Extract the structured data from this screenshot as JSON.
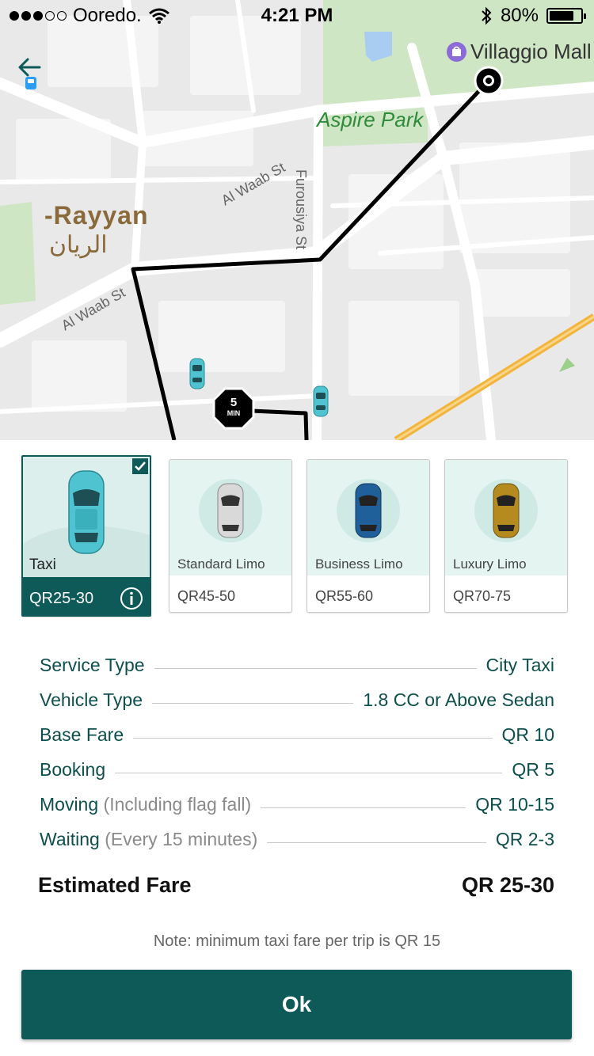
{
  "status_bar": {
    "carrier": "Ooredo.",
    "time": "4:21 PM",
    "battery": "80%",
    "signal_level": 3,
    "signal_total": 5
  },
  "map": {
    "labels": {
      "villaggio": "Villaggio Mall",
      "aspire": "Aspire Park",
      "rayyan": "-Rayyan",
      "rayyan_ar": "الريان",
      "al_waab_1": "Al Waab St",
      "al_waab_2": "Al Waab St",
      "furousiya": "Furousiya St"
    },
    "eta": {
      "value": "5",
      "unit": "MIN"
    },
    "icons": [
      "back-arrow-icon",
      "bus-icon",
      "mall-icon",
      "destination-pin-icon",
      "taxi-car-icon"
    ]
  },
  "vehicles": [
    {
      "name": "Taxi",
      "price": "QR25-30",
      "selected": true,
      "color": "#4fc3cf"
    },
    {
      "name": "Standard Limo",
      "price": "QR45-50",
      "selected": false,
      "color": "#d9d9d9"
    },
    {
      "name": "Business Limo",
      "price": "QR55-60",
      "selected": false,
      "color": "#1f5f9a"
    },
    {
      "name": "Luxury Limo",
      "price": "QR70-75",
      "selected": false,
      "color": "#b58a1f"
    }
  ],
  "fare": {
    "rows": [
      {
        "label": "Service Type",
        "sub": "",
        "value": "City Taxi"
      },
      {
        "label": "Vehicle Type",
        "sub": "",
        "value": "1.8 CC or Above Sedan"
      },
      {
        "label": "Base Fare",
        "sub": "",
        "value": "QR 10"
      },
      {
        "label": "Booking",
        "sub": "",
        "value": "QR 5"
      },
      {
        "label": "Moving",
        "sub": "(Including flag fall)",
        "value": "QR 10-15"
      },
      {
        "label": "Waiting",
        "sub": "(Every 15 minutes)",
        "value": "QR 2-3"
      }
    ],
    "estimated_label": "Estimated Fare",
    "estimated_value": "QR 25-30"
  },
  "note": "Note: minimum taxi fare per trip is QR 15",
  "ok_label": "Ok",
  "colors": {
    "brand": "#0d5a58",
    "text": "#0d4f4d",
    "map_bg": "#e9e9ea",
    "park": "#cfe6c4",
    "route": "#000000",
    "highway": "#f2b53c"
  }
}
